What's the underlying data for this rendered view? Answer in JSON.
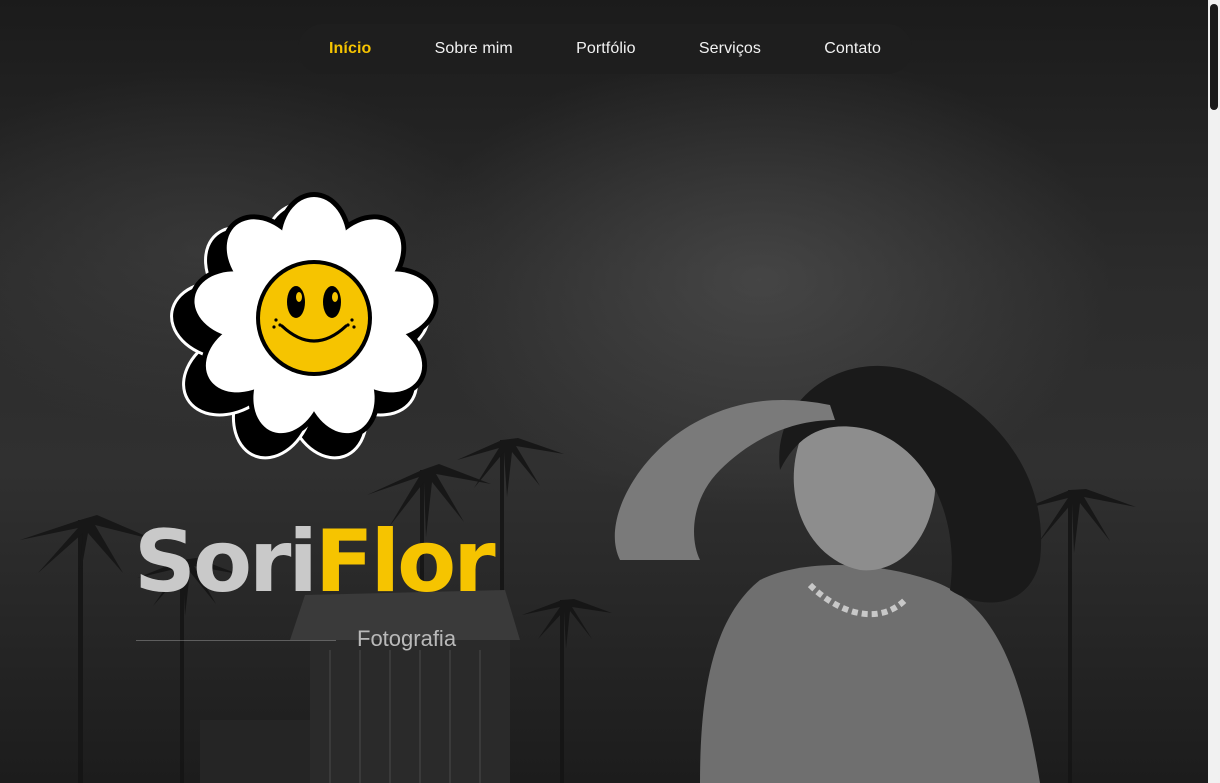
{
  "nav": {
    "items": [
      {
        "label": "Início",
        "active": true
      },
      {
        "label": "Sobre mim",
        "active": false
      },
      {
        "label": "Portfólio",
        "active": false
      },
      {
        "label": "Serviços",
        "active": false
      },
      {
        "label": "Contato",
        "active": false
      }
    ]
  },
  "hero": {
    "brand_part1": "Sori",
    "brand_part2": "Flor",
    "tagline": "Fotografia"
  },
  "colors": {
    "accent": "#f6c400",
    "background": "#1f1f1f",
    "nav_text": "#f2f2f2"
  },
  "icons": {
    "logo": "smiling-daisy-icon"
  }
}
